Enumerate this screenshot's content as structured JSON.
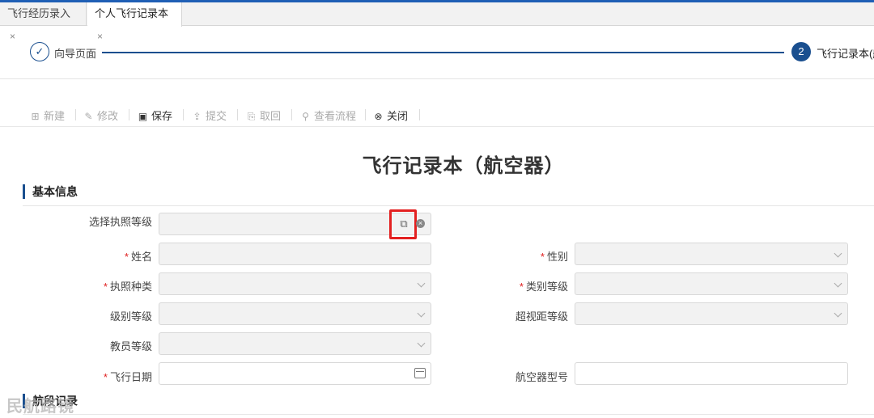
{
  "tabs": [
    {
      "label": "飞行经历录入",
      "close": "×"
    },
    {
      "label": "个人飞行记录本",
      "close": "×"
    }
  ],
  "steps": [
    {
      "num": "✓",
      "label": "向导页面"
    },
    {
      "num": "2",
      "label": "飞行记录本(航"
    }
  ],
  "toolbar": {
    "new": "新建",
    "edit": "修改",
    "save": "保存",
    "submit": "提交",
    "withdraw": "取回",
    "flow": "查看流程",
    "close": "关闭"
  },
  "form": {
    "title": "飞行记录本（航空器）",
    "section_basic": "基本信息",
    "section_legs": "航段记录",
    "required_mark": "*",
    "fields": {
      "license_level": "选择执照等级",
      "name": "姓名",
      "gender": "性别",
      "license_type": "执照种类",
      "category_level": "类别等级",
      "grade_level": "级别等级",
      "bvr_level": "超视距等级",
      "instructor_level": "教员等级",
      "flight_date": "飞行日期",
      "aircraft_model": "航空器型号"
    }
  },
  "watermark": "民航路镜"
}
